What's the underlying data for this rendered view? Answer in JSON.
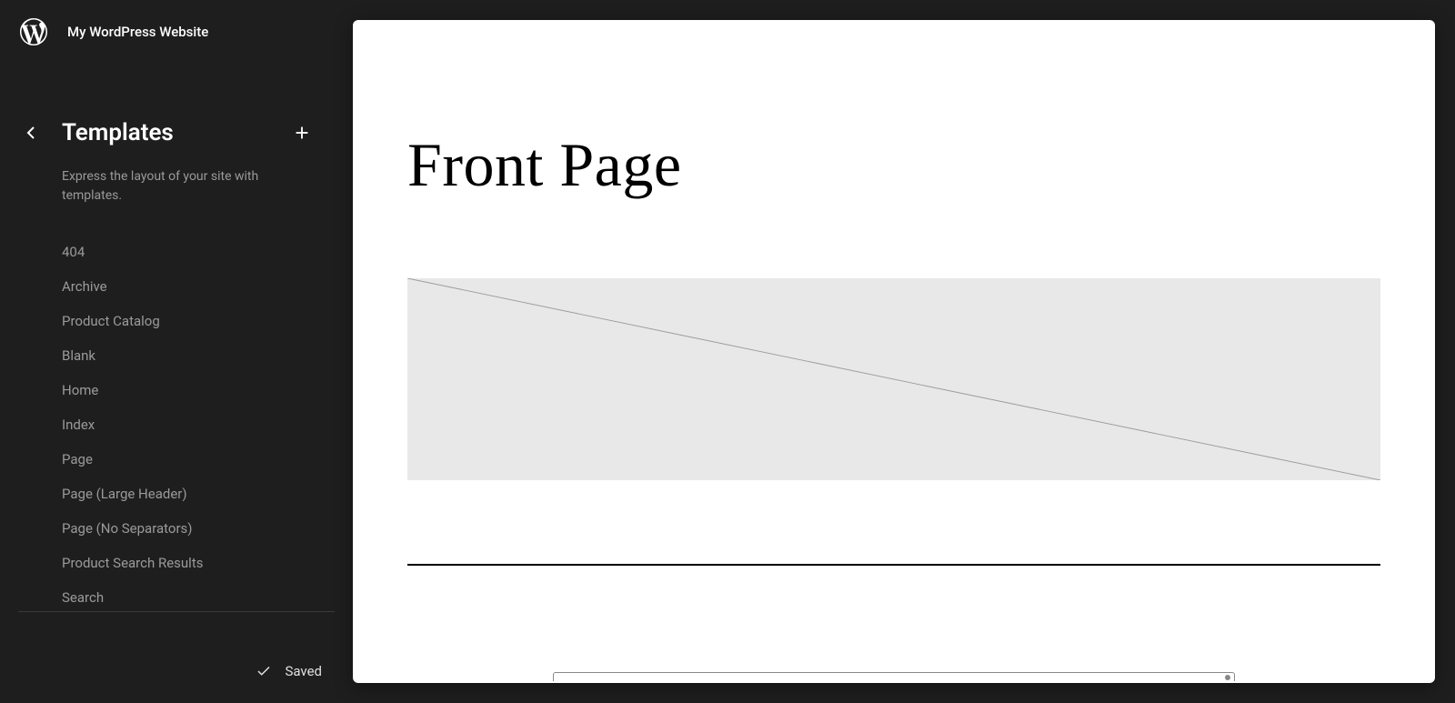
{
  "site": {
    "title": "My WordPress Website"
  },
  "section": {
    "title": "Templates",
    "description": "Express the layout of your site with templates."
  },
  "templates": [
    {
      "label": "404"
    },
    {
      "label": "Archive"
    },
    {
      "label": "Product Catalog"
    },
    {
      "label": "Blank"
    },
    {
      "label": "Home"
    },
    {
      "label": "Index"
    },
    {
      "label": "Page"
    },
    {
      "label": "Page (Large Header)"
    },
    {
      "label": "Page (No Separators)"
    },
    {
      "label": "Product Search Results"
    },
    {
      "label": "Search"
    }
  ],
  "status": {
    "saved_label": "Saved"
  },
  "preview": {
    "heading": "Front Page"
  }
}
